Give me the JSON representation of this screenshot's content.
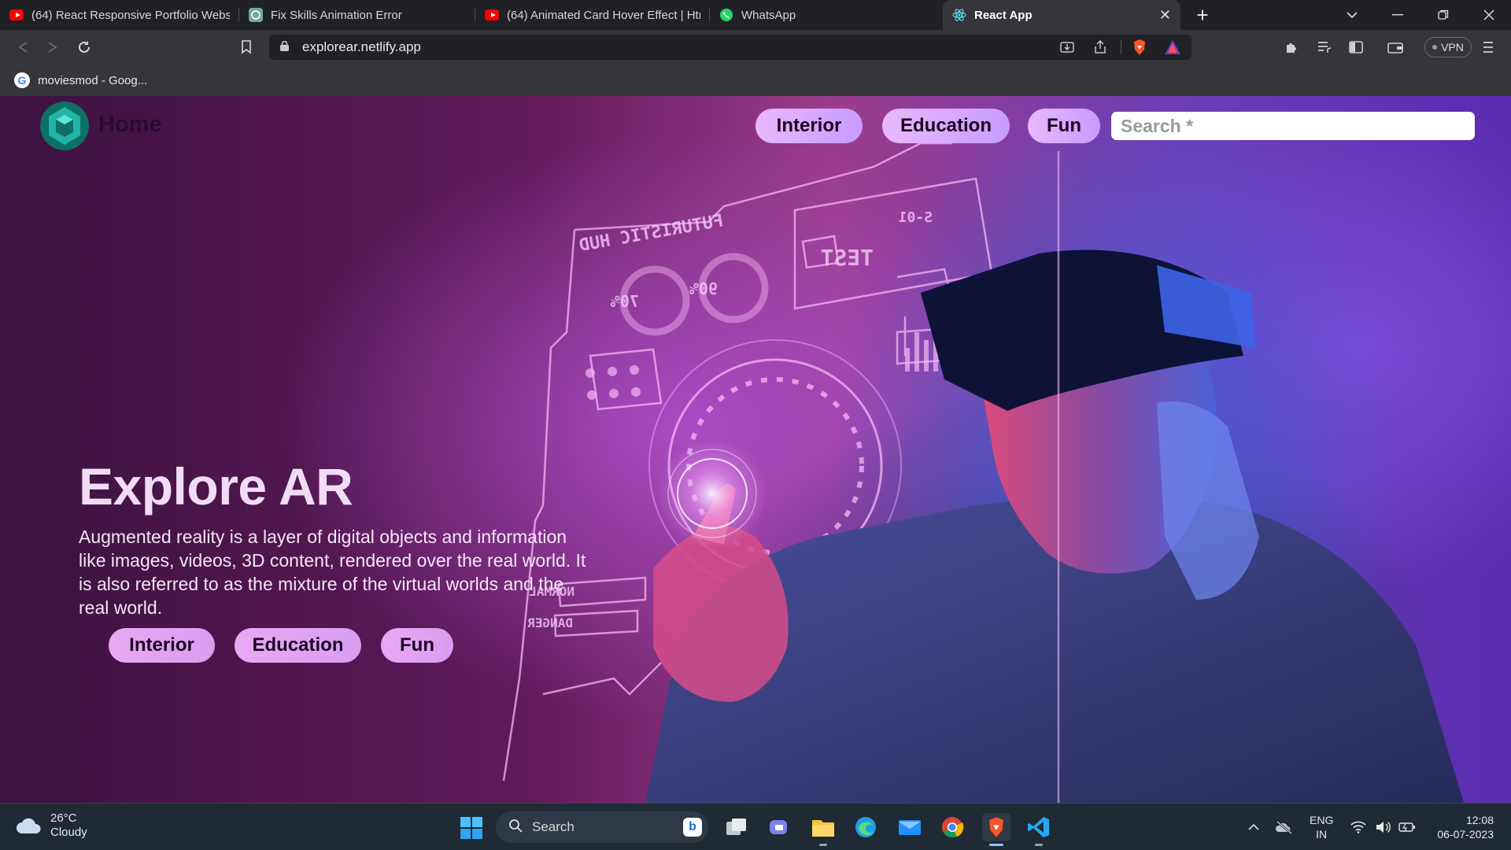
{
  "browser": {
    "tabs": [
      {
        "label": "(64) React Responsive Portfolio Websit",
        "icon": "youtube-icon"
      },
      {
        "label": "Fix Skills Animation Error",
        "icon": "chatgpt-icon"
      },
      {
        "label": "(64) Animated Card Hover Effect | Htm",
        "icon": "youtube-icon"
      },
      {
        "label": "WhatsApp",
        "icon": "whatsapp-icon"
      },
      {
        "label": "React App",
        "icon": "react-icon",
        "active": true
      }
    ],
    "close_glyph": "✕",
    "new_tab_glyph": "+",
    "url": "explorear.netlify.app",
    "vpn_label": "VPN",
    "bookmark": {
      "label": "moviesmod - Goog...",
      "icon": "google-icon"
    }
  },
  "site": {
    "home_label": "Home",
    "nav": [
      "Interior",
      "Education",
      "Fun"
    ],
    "search_placeholder": "Search *",
    "hero": {
      "title": "Explore AR",
      "text": "Augmented reality is a layer of digital objects and information like images, videos, 3D content, rendered over the real world. It is also referred to as the mixture of the virtual worlds and the real world.",
      "buttons": [
        "Interior",
        "Education",
        "Fun"
      ]
    },
    "hud_text": {
      "futuristic": "FUTURISTIC HUD",
      "test": "TEST",
      "code": "S-01",
      "pct1": "70%",
      "pct2": "90%",
      "normal": "NORMAL",
      "danger": "DANGER"
    },
    "colors": {
      "accent_pill": "#d9a6f8",
      "logo": "#1fb5a8"
    }
  },
  "taskbar": {
    "weather": {
      "temp": "26°C",
      "condition": "Cloudy"
    },
    "search_label": "Search",
    "lang": {
      "line1": "ENG",
      "line2": "IN"
    },
    "clock": {
      "time": "12:08",
      "date": "06-07-2023"
    }
  }
}
